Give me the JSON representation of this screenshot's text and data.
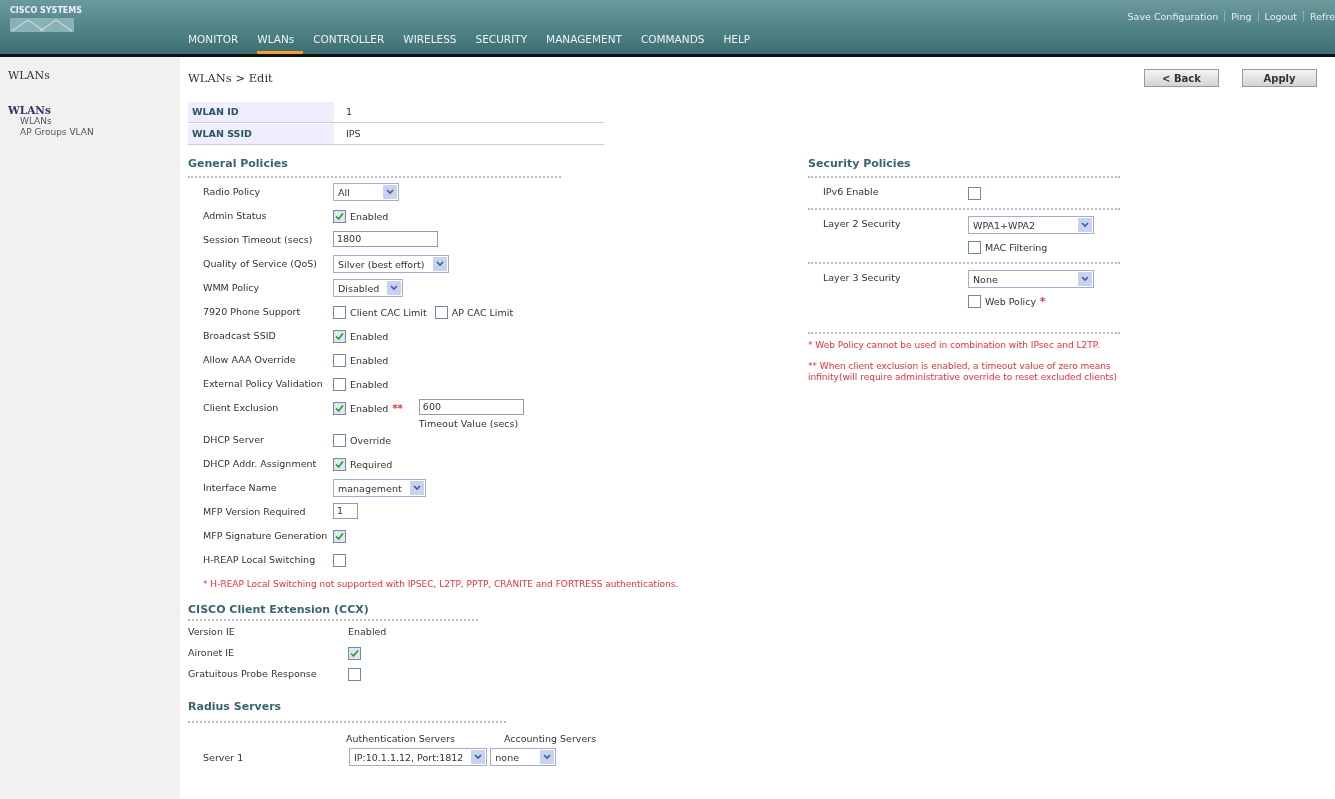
{
  "header": {
    "logo": "CISCO SYSTEMS",
    "links": [
      "Save Configuration",
      "Ping",
      "Logout",
      "Refre"
    ],
    "nav": [
      {
        "label": "MONITOR",
        "selected": false
      },
      {
        "label": "WLANs",
        "selected": true
      },
      {
        "label": "CONTROLLER",
        "selected": false
      },
      {
        "label": "WIRELESS",
        "selected": false
      },
      {
        "label": "SECURITY",
        "selected": false
      },
      {
        "label": "MANAGEMENT",
        "selected": false
      },
      {
        "label": "COMMANDS",
        "selected": false
      },
      {
        "label": "HELP",
        "selected": false
      }
    ]
  },
  "sidebar": {
    "title": "WLANs",
    "section": "WLANs",
    "items": [
      "WLANs",
      "AP Groups VLAN"
    ]
  },
  "breadcrumb": "WLANs > Edit",
  "buttons": [
    "< Back",
    "Apply"
  ],
  "wlan": [
    {
      "label": "WLAN ID",
      "value": "1"
    },
    {
      "label": "WLAN SSID",
      "value": "IPS"
    }
  ],
  "general": {
    "title": "General Policies",
    "rows": [
      {
        "label": "Radio Policy",
        "controls": [
          {
            "kind": "select",
            "value": "All"
          }
        ]
      },
      {
        "label": "Admin Status",
        "controls": [
          {
            "kind": "checkbox",
            "checked": true,
            "text": "Enabled"
          }
        ]
      },
      {
        "label": "Session Timeout (secs)",
        "controls": [
          {
            "kind": "input",
            "value": "1800"
          }
        ]
      },
      {
        "label": "Quality of Service (QoS)",
        "controls": [
          {
            "kind": "select",
            "value": "Silver (best effort)"
          }
        ]
      },
      {
        "label": "WMM Policy",
        "controls": [
          {
            "kind": "select",
            "value": "Disabled"
          }
        ]
      },
      {
        "label": "7920 Phone Support",
        "controls": [
          {
            "kind": "checkbox",
            "checked": false,
            "text": "Client CAC Limit"
          },
          {
            "kind": "checkbox",
            "checked": false,
            "text": "AP CAC Limit"
          }
        ]
      },
      {
        "label": "Broadcast SSID",
        "controls": [
          {
            "kind": "checkbox",
            "checked": true,
            "text": "Enabled"
          }
        ]
      },
      {
        "label": "Allow AAA Override",
        "controls": [
          {
            "kind": "checkbox",
            "checked": false,
            "text": "Enabled"
          }
        ]
      },
      {
        "label": "External Policy Validation",
        "controls": [
          {
            "kind": "checkbox",
            "checked": false,
            "text": "Enabled"
          }
        ]
      },
      {
        "label": "Client Exclusion",
        "controls": [
          {
            "kind": "checkbox",
            "checked": true,
            "text": "Enabled",
            "mark": "**"
          },
          {
            "kind": "input",
            "value": "600",
            "caption": "Timeout Value (secs)"
          }
        ]
      },
      {
        "label": "DHCP Server",
        "controls": [
          {
            "kind": "checkbox",
            "checked": false,
            "text": "Override"
          }
        ]
      },
      {
        "label": "DHCP Addr. Assignment",
        "controls": [
          {
            "kind": "checkbox",
            "checked": true,
            "text": "Required"
          }
        ]
      },
      {
        "label": "Interface Name",
        "controls": [
          {
            "kind": "select",
            "value": "management"
          }
        ]
      },
      {
        "label": "MFP Version Required",
        "controls": [
          {
            "kind": "input",
            "value": "1"
          }
        ]
      },
      {
        "label": "MFP Signature Generation",
        "controls": [
          {
            "kind": "checkbox",
            "checked": true
          }
        ]
      },
      {
        "label": "H-REAP Local Switching",
        "controls": [
          {
            "kind": "checkbox",
            "checked": false
          }
        ]
      }
    ],
    "note": "* H-REAP Local Switching not supported with IPSEC, L2TP, PPTP, CRANITE and FORTRESS authentications."
  },
  "ccx": {
    "title": "CISCO Client Extension (CCX)",
    "rows": [
      {
        "label": "Version IE",
        "controls": [
          {
            "kind": "text",
            "value": "Enabled"
          }
        ]
      },
      {
        "label": "Aironet IE",
        "controls": [
          {
            "kind": "checkbox",
            "checked": true
          }
        ]
      },
      {
        "label": "Gratuitous Probe Response",
        "controls": [
          {
            "kind": "checkbox",
            "checked": false
          }
        ]
      }
    ]
  },
  "radius": {
    "title": "Radius Servers",
    "columns": [
      "Authentication Servers",
      "Accounting Servers"
    ],
    "rows": [
      {
        "label": "Server 1",
        "auth": "IP:10.1.1.12, Port:1812",
        "acct": "none"
      }
    ]
  },
  "security": {
    "title": "Security Policies",
    "rows": [
      {
        "label": "IPv6 Enable",
        "controls": [
          {
            "kind": "checkbox",
            "checked": false
          }
        ]
      },
      {
        "label": "Layer 2 Security",
        "controls": [
          {
            "kind": "select",
            "value": "WPA1+WPA2"
          },
          {
            "kind": "checkbox",
            "checked": false,
            "text": "MAC Filtering"
          }
        ]
      },
      {
        "label": "Layer 3 Security",
        "controls": [
          {
            "kind": "select",
            "value": "None"
          },
          {
            "kind": "checkbox",
            "checked": false,
            "text": "Web Policy",
            "mark": "*"
          }
        ]
      }
    ],
    "notes": [
      "* Web Policy cannot be used in combination with IPsec and L2TP.",
      "** When client exclusion is enabled, a timeout value of zero means infinity(will require administrative override to reset excluded clients)"
    ]
  }
}
